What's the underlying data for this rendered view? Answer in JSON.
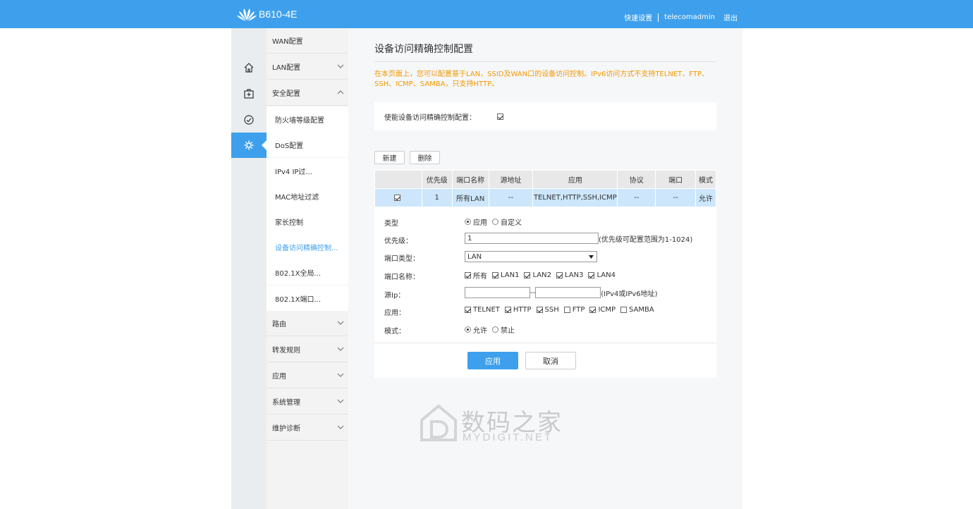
{
  "header": {
    "model": "B610-4E",
    "quick_setup": "快速设置",
    "user": "telecomadmin",
    "logout": "退出"
  },
  "iconbar": [
    {
      "icon": "home-icon"
    },
    {
      "icon": "medical-kit-icon"
    },
    {
      "icon": "gauge-icon"
    },
    {
      "icon": "gear-icon",
      "active": true
    }
  ],
  "menu": {
    "wan": "WAN配置",
    "lan": "LAN配置",
    "security": "安全配置",
    "security_items": [
      "防火墙等级配置",
      "DoS配置",
      "IPv4 IP过...",
      "MAC地址过滤",
      "家长控制",
      "设备访问精确控制...",
      "802.1X全局...",
      "802.1X端口..."
    ],
    "routing": "路由",
    "forward": "转发规则",
    "apps": "应用",
    "sysmgmt": "系统管理",
    "diag": "维护诊断"
  },
  "page": {
    "title": "设备访问精确控制配置",
    "notice": "在本页面上，您可以配置基于LAN，SSID及WAN口的设备访问控制。IPv6访问方式不支持TELNET、FTP、SSH、ICMP、SAMBA，只支持HTTP。",
    "enable_label": "使能设备访问精确控制配置：",
    "enable_checked": true,
    "new_btn": "新建",
    "delete_btn": "删除"
  },
  "table": {
    "headers": [
      "",
      "优先级",
      "端口名称",
      "源地址",
      "应用",
      "协议",
      "端口",
      "模式"
    ],
    "rows": [
      {
        "checked": true,
        "cells": [
          "1",
          "所有LAN",
          "--",
          "TELNET,HTTP,SSH,ICMP",
          "--",
          "--",
          "允许"
        ]
      }
    ]
  },
  "form": {
    "type_label": "类型",
    "type_opts": [
      "应用",
      "自定义"
    ],
    "priority_label": "优先级：",
    "priority_value": "1",
    "priority_hint": "(优先级可配置范围为1-1024)",
    "porttype_label": "端口类型：",
    "porttype_value": "LAN",
    "portname_label": "端口名称：",
    "ports": [
      "所有",
      "LAN1",
      "LAN2",
      "LAN3",
      "LAN4"
    ],
    "srcip_label": "源Ip：",
    "srcip_sep": "--",
    "srcip_hint": "(IPv4或IPv6地址)",
    "app_label": "应用：",
    "apps": [
      {
        "name": "TELNET",
        "on": true
      },
      {
        "name": "HTTP",
        "on": true
      },
      {
        "name": "SSH",
        "on": true
      },
      {
        "name": "FTP",
        "on": false
      },
      {
        "name": "ICMP",
        "on": true
      },
      {
        "name": "SAMBA",
        "on": false
      }
    ],
    "mode_label": "模式：",
    "mode_opts": [
      "允许",
      "禁止"
    ],
    "apply": "应用",
    "cancel": "取消"
  },
  "watermark": {
    "cn": "数码之家",
    "en": "MYDIGIT.NET"
  }
}
